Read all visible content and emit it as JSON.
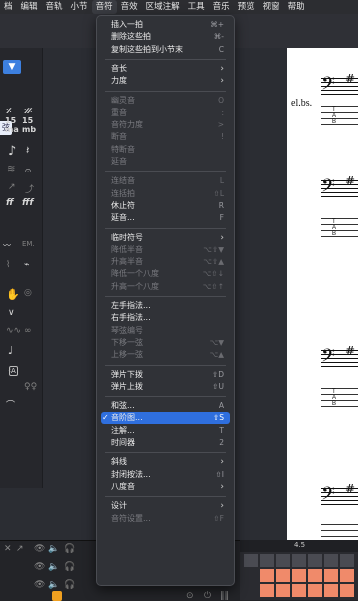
{
  "menubar": {
    "items": [
      "档",
      "编辑",
      "音轨",
      "小节",
      "音符",
      "音效",
      "区域注解",
      "工具",
      "音乐",
      "预览",
      "视窗",
      "帮助"
    ],
    "active_index": 4
  },
  "menu": {
    "items": [
      {
        "label": "插入一拍",
        "shortcut": "⌘+",
        "enabled": true
      },
      {
        "label": "删除这些拍",
        "shortcut": "⌘-",
        "enabled": true
      },
      {
        "label": "复制这些拍到小节末",
        "shortcut": "C",
        "enabled": true
      },
      {
        "sep": true
      },
      {
        "label": "音长",
        "submenu": true,
        "enabled": true
      },
      {
        "label": "力度",
        "submenu": true,
        "enabled": true
      },
      {
        "sep": true
      },
      {
        "label": "幽灵音",
        "shortcut": "O",
        "enabled": false
      },
      {
        "label": "重音",
        "shortcut": ":",
        "enabled": false
      },
      {
        "label": "音符力度",
        "shortcut": ">",
        "enabled": false
      },
      {
        "label": "断音",
        "shortcut": "!",
        "enabled": false
      },
      {
        "label": "特断音",
        "shortcut": "",
        "enabled": false
      },
      {
        "label": "延音",
        "shortcut": "",
        "enabled": false
      },
      {
        "sep": true
      },
      {
        "label": "连结音",
        "shortcut": "L",
        "enabled": false
      },
      {
        "label": "连括拍",
        "shortcut": "⇧L",
        "enabled": false
      },
      {
        "label": "休止符",
        "shortcut": "R",
        "enabled": true
      },
      {
        "label": "延音...",
        "shortcut": "F",
        "enabled": true
      },
      {
        "sep": true
      },
      {
        "label": "临时符号",
        "submenu": true,
        "enabled": true
      },
      {
        "label": "降低半音",
        "shortcut": "⌥⇧▼",
        "enabled": false
      },
      {
        "label": "升高半音",
        "shortcut": "⌥⇧▲",
        "enabled": false
      },
      {
        "label": "降低一个八度",
        "shortcut": "⌥⇧↓",
        "enabled": false
      },
      {
        "label": "升高一个八度",
        "shortcut": "⌥⇧↑",
        "enabled": false
      },
      {
        "sep": true
      },
      {
        "label": "左手指法...",
        "shortcut": "",
        "enabled": true
      },
      {
        "label": "右手指法...",
        "shortcut": "",
        "enabled": true
      },
      {
        "label": "琴弦编号",
        "shortcut": "",
        "enabled": false
      },
      {
        "label": "下移一弦",
        "shortcut": "⌥▼",
        "enabled": false
      },
      {
        "label": "上移一弦",
        "shortcut": "⌥▲",
        "enabled": false
      },
      {
        "sep": true
      },
      {
        "label": "弹片下拨",
        "shortcut": "⇧D",
        "enabled": true
      },
      {
        "label": "弹片上拨",
        "shortcut": "⇧U",
        "enabled": true
      },
      {
        "sep": true
      },
      {
        "label": "和弦...",
        "shortcut": "A",
        "enabled": true
      },
      {
        "label": "音阶图...",
        "shortcut": "⇧S",
        "enabled": true,
        "checked": true,
        "selected": true
      },
      {
        "label": "注解...",
        "shortcut": "T",
        "enabled": true
      },
      {
        "label": "时间器",
        "shortcut": "2",
        "enabled": true
      },
      {
        "sep": true
      },
      {
        "label": "斜线",
        "submenu": true,
        "enabled": true
      },
      {
        "label": "封闭按法...",
        "shortcut": "⇧I",
        "enabled": true
      },
      {
        "label": "八度音",
        "submenu": true,
        "enabled": true
      },
      {
        "sep": true
      },
      {
        "label": "设计",
        "submenu": true,
        "enabled": true
      },
      {
        "label": "音符设置...",
        "shortcut": "⇧F",
        "enabled": false
      }
    ]
  },
  "score": {
    "instrument_label": "el.bs.",
    "tab_letters": [
      "T",
      "A",
      "B"
    ],
    "clef": "𝄢",
    "sharp": "#"
  },
  "palette": {
    "tag_text": "弦",
    "box_symbol": "▼",
    "items": [
      "𝄎",
      "𝄏",
      "15ma",
      "15mb",
      "♪",
      "𝄽",
      "𝄐",
      "ff",
      "fff",
      "EM.",
      "A"
    ]
  },
  "timeline": {
    "ruler_label": "4.5"
  },
  "colors": {
    "accent": "#2f6fde",
    "menu_bg": "#303237",
    "timeline_cell": "#f08a6a"
  }
}
